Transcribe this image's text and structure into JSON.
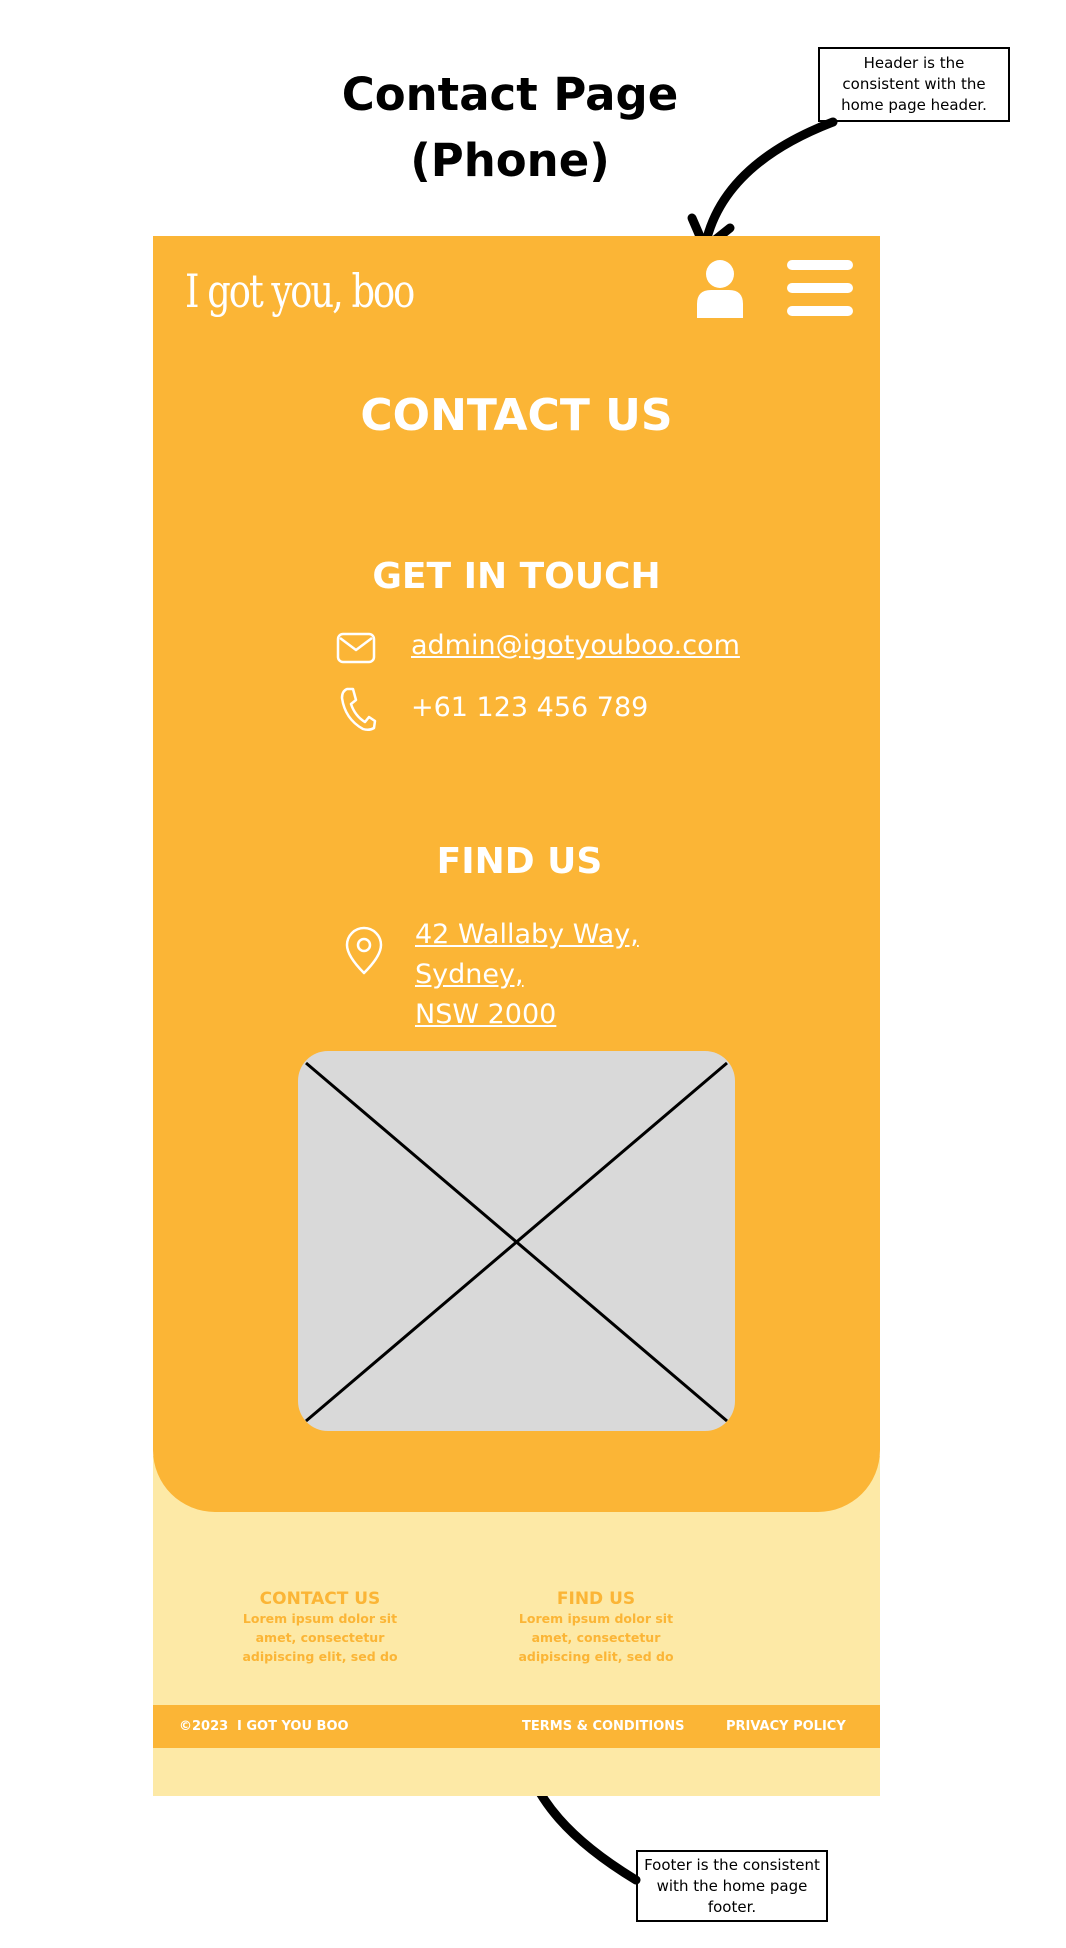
{
  "page": {
    "title_line1": "Contact Page",
    "title_line2": "(Phone)"
  },
  "annotations": {
    "header_note": "Header is the consistent with the home page header.",
    "footer_note": "Footer is the consistent with the home page footer."
  },
  "header": {
    "logo": "I got you, boo",
    "icons": [
      "user-icon",
      "menu-icon"
    ]
  },
  "main": {
    "heading": "CONTACT US",
    "get_in_touch": {
      "heading": "GET IN TOUCH",
      "email": "admin@igotyouboo.com",
      "phone": "+61 123 456 789"
    },
    "find_us": {
      "heading": "FIND US",
      "address_line1": "42 Wallaby Way, Sydney,",
      "address_line2": "NSW 2000"
    }
  },
  "footer": {
    "columns": [
      {
        "heading": "CONTACT US",
        "lines": [
          "Lorem ipsum dolor sit",
          "amet, consectetur",
          "adipiscing elit, sed do"
        ]
      },
      {
        "heading": "FIND US",
        "lines": [
          "Lorem ipsum dolor sit",
          "amet, consectetur",
          "adipiscing elit, sed do"
        ]
      }
    ],
    "copyright": "©2023",
    "brand": "I GOT YOU BOO",
    "terms": "TERMS & CONDITIONS",
    "privacy": "PRIVACY POLICY"
  },
  "colors": {
    "primary": "#fbb536",
    "footer_light": "#fde9a6",
    "map_placeholder": "#d9d9d9",
    "text_light": "#ffffff"
  }
}
